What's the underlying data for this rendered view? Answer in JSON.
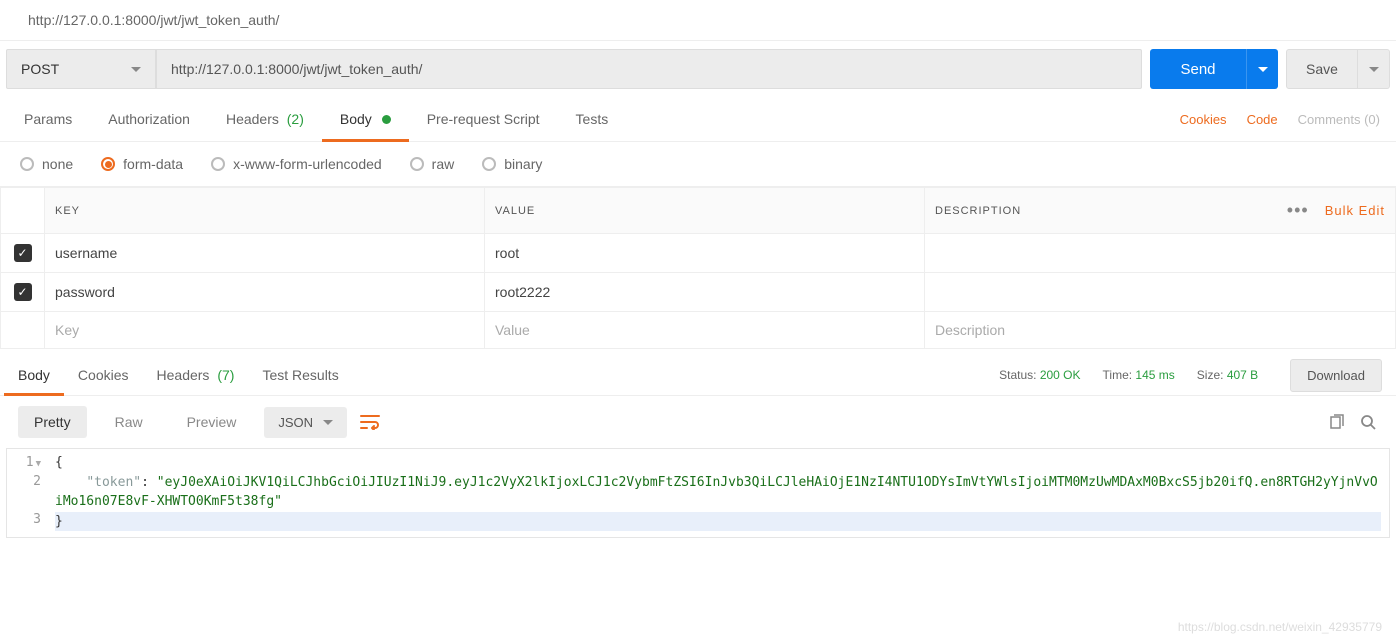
{
  "tabTitle": "http://127.0.0.1:8000/jwt/jwt_token_auth/",
  "request": {
    "method": "POST",
    "url": "http://127.0.0.1:8000/jwt/jwt_token_auth/",
    "sendLabel": "Send",
    "saveLabel": "Save"
  },
  "reqTabs": {
    "params": "Params",
    "authorization": "Authorization",
    "headers": "Headers",
    "headersCount": "(2)",
    "body": "Body",
    "prerequest": "Pre-request Script",
    "tests": "Tests",
    "cookies": "Cookies",
    "code": "Code",
    "comments": "Comments (0)"
  },
  "bodyTypes": {
    "none": "none",
    "formdata": "form-data",
    "urlencoded": "x-www-form-urlencoded",
    "raw": "raw",
    "binary": "binary"
  },
  "kv": {
    "headKey": "KEY",
    "headValue": "VALUE",
    "headDesc": "DESCRIPTION",
    "bulkEdit": "Bulk Edit",
    "rows": [
      {
        "key": "username",
        "value": "root"
      },
      {
        "key": "password",
        "value": "root2222"
      }
    ],
    "phKey": "Key",
    "phValue": "Value",
    "phDesc": "Description"
  },
  "respTabs": {
    "body": "Body",
    "cookies": "Cookies",
    "headers": "Headers",
    "headersCount": "(7)",
    "testResults": "Test Results"
  },
  "respMeta": {
    "statusLabel": "Status:",
    "statusValue": "200 OK",
    "timeLabel": "Time:",
    "timeValue": "145 ms",
    "sizeLabel": "Size:",
    "sizeValue": "407 B",
    "download": "Download"
  },
  "viewer": {
    "pretty": "Pretty",
    "raw": "Raw",
    "preview": "Preview",
    "lang": "JSON"
  },
  "response": {
    "line1": "{",
    "line2a": "    \"token\"",
    "line2b": ": ",
    "line2c": "\"eyJ0eXAiOiJKV1QiLCJhbGciOiJIUzI1NiJ9.eyJ1c2VyX2lkIjoxLCJ1c2VybmFtZSI6InJvb3QiLCJleHAiOjE1NzI4NTU1ODYsImVtYWlsIjoiMTM0MzUwMDAxM0BxcS5jb20ifQ.en8RTGH2yYjnVvOiMo16n07E8vF-XHWTO0KmF5t38fg\"",
    "line3": "}"
  },
  "watermark": "https://blog.csdn.net/weixin_42935779"
}
